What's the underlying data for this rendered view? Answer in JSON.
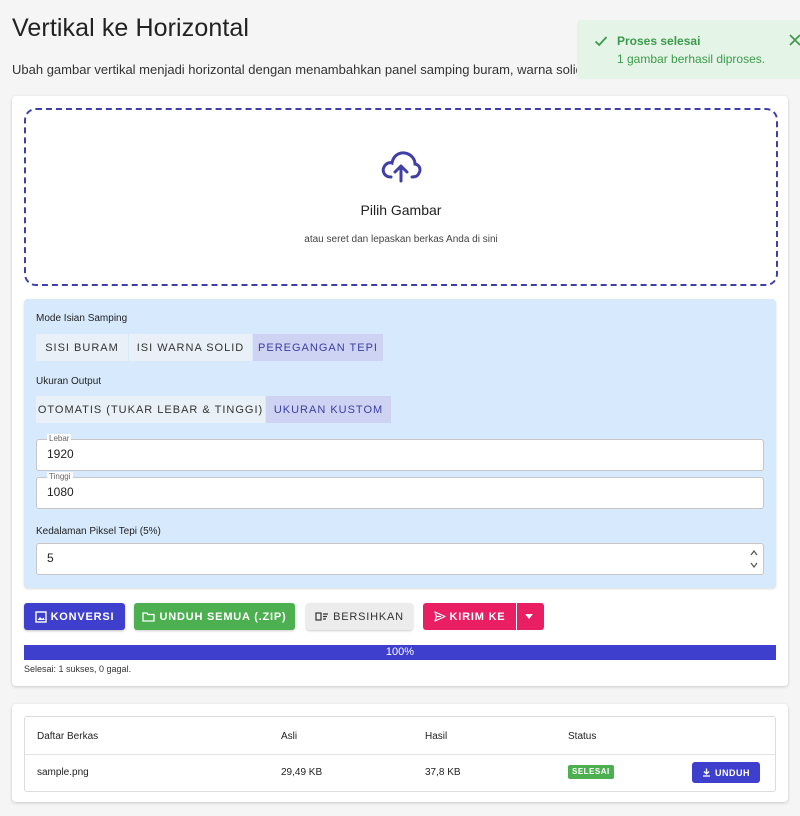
{
  "page": {
    "title": "Vertikal ke Horizontal",
    "subtitle": "Ubah gambar vertikal menjadi horizontal dengan menambahkan panel samping buram, warna solid,"
  },
  "toast": {
    "title": "Proses selesai",
    "message": "1 gambar berhasil diproses.",
    "icon": "check-icon",
    "color": "#3c9b4b"
  },
  "dropzone": {
    "title": "Pilih Gambar",
    "hint": "atau seret dan lepaskan berkas Anda di sini",
    "icon": "cloud-upload-icon"
  },
  "settings": {
    "fill_mode_label": "Mode Isian Samping",
    "fill_modes": [
      "SISI BURAM",
      "ISI WARNA SOLID",
      "PEREGANGAN TEPI"
    ],
    "fill_mode_selected": "PEREGANGAN TEPI",
    "output_size_label": "Ukuran Output",
    "output_sizes": [
      "OTOMATIS (TUKAR LEBAR & TINGGI)",
      "UKURAN KUSTOM"
    ],
    "output_size_selected": "UKURAN KUSTOM",
    "width_label": "Lebar",
    "width_value": "1920",
    "height_label": "Tinggi",
    "height_value": "1080",
    "edge_depth_label": "Kedalaman Piksel Tepi (5%)",
    "edge_depth_value": "5"
  },
  "actions": {
    "convert": "KONVERSI",
    "download_all": "UNDUH SEMUA (.ZIP)",
    "clear": "BERSIHKAN",
    "send_to": "KIRIM KE"
  },
  "progress": {
    "percent": 100,
    "label": "100%",
    "status": "Selesai: 1 sukses, 0 gagal."
  },
  "file_table": {
    "headers": [
      "Daftar Berkas",
      "Asli",
      "Hasil",
      "Status"
    ],
    "rows": [
      {
        "name": "sample.png",
        "original": "29,49 KB",
        "result": "37,8 KB",
        "status": "SELESAI",
        "action": "UNDUH"
      }
    ]
  },
  "colors": {
    "primary": "#3f3fce",
    "success": "#4caf50",
    "accent": "#e91e63",
    "panel": "#d6e9fd"
  }
}
